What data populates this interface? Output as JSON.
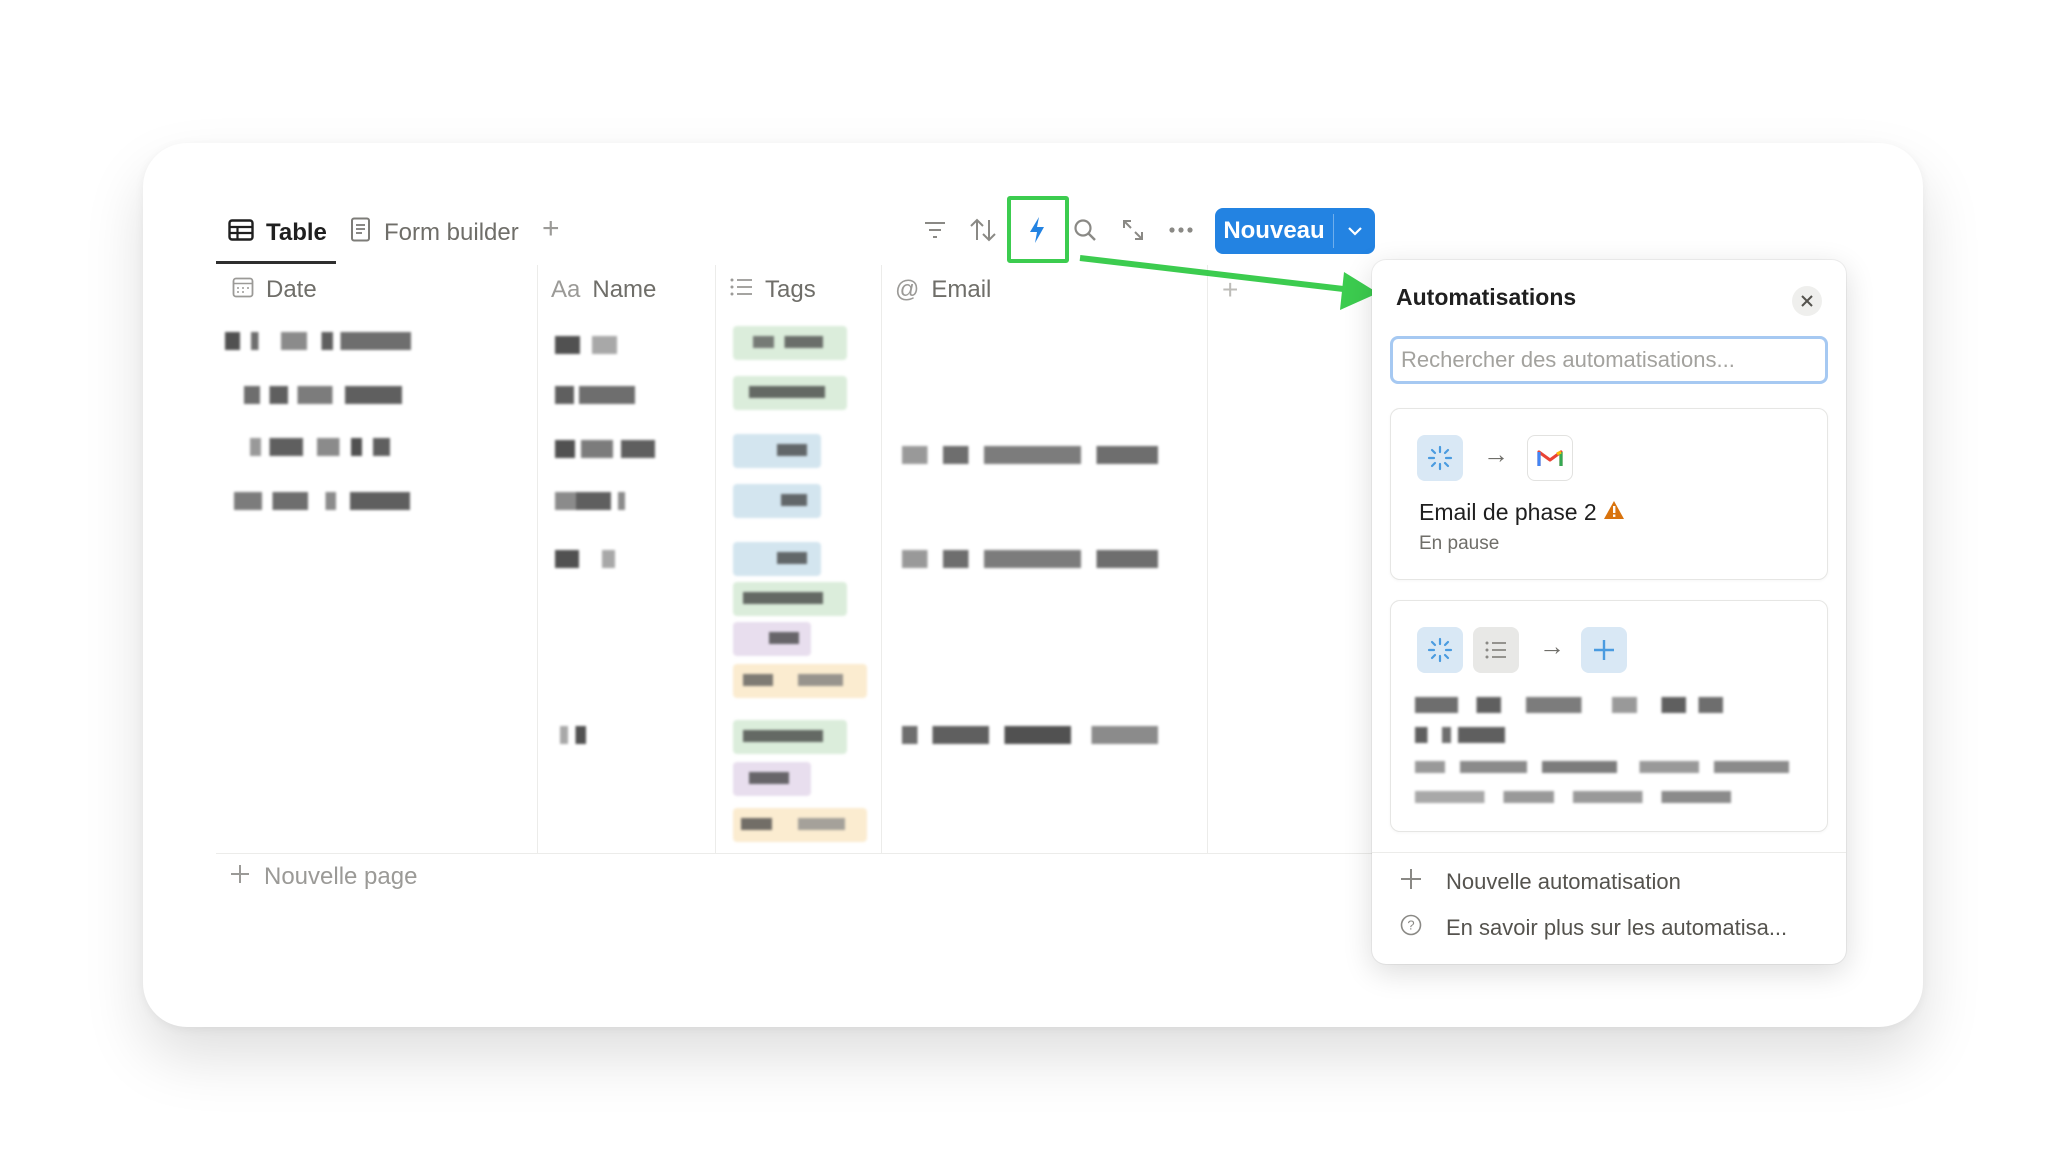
{
  "tabs": [
    {
      "label": "Table",
      "icon": "table-icon",
      "active": true
    },
    {
      "label": "Form builder",
      "icon": "page-icon",
      "active": false
    }
  ],
  "toolbar": {
    "icons": [
      "filter-icon",
      "sort-icon",
      "lightning-icon",
      "search-icon",
      "expand-icon",
      "more-icon"
    ],
    "new_label": "Nouveau"
  },
  "columns": [
    {
      "label": "Date",
      "icon": "calendar-icon"
    },
    {
      "label": "Name",
      "icon": "aa-icon",
      "prefix": "Aa"
    },
    {
      "label": "Tags",
      "icon": "list-icon"
    },
    {
      "label": "Email",
      "icon": "at-icon",
      "prefix": "@"
    }
  ],
  "new_page_label": "Nouvelle page",
  "automations": {
    "title": "Automatisations",
    "search_placeholder": "Rechercher des automatisations...",
    "cards": [
      {
        "title": "Email de phase 2",
        "status": "En pause",
        "warning": true,
        "trigger_icons": [
          "sparkle-icon"
        ],
        "action_icons": [
          "gmail-icon"
        ]
      },
      {
        "title": "",
        "status": "",
        "trigger_icons": [
          "sparkle-icon",
          "list-icon"
        ],
        "action_icons": [
          "plus-icon"
        ]
      }
    ],
    "new_label": "Nouvelle automatisation",
    "learn_label": "En savoir plus sur les automatisa..."
  },
  "colors": {
    "accent": "#2383e2",
    "highlight": "#3ccc4f",
    "warning": "#d9730d",
    "tag_green": "#dbeddb",
    "tag_blue": "#d3e5ef",
    "tag_purple": "#e8deee",
    "tag_yellow": "#fbecd0"
  }
}
